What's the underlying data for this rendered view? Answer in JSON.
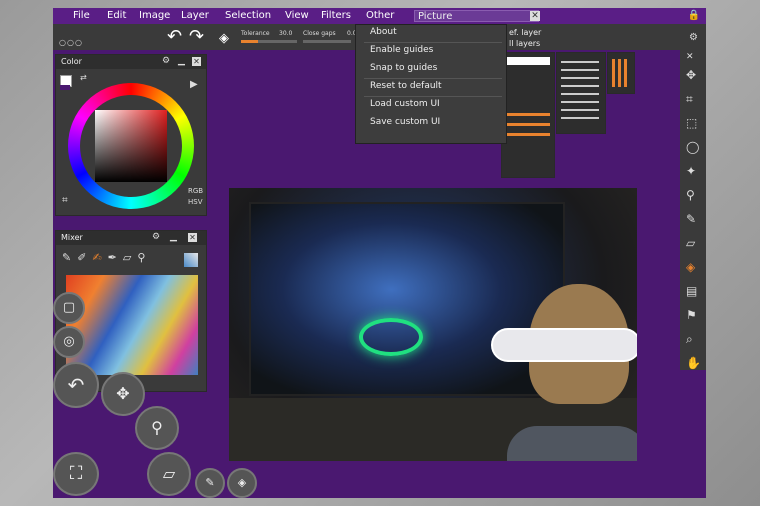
{
  "menu": [
    "File",
    "Edit",
    "Image",
    "Layer",
    "Selection",
    "View",
    "Filters",
    "Other"
  ],
  "picture_field": {
    "value": "Picture"
  },
  "toolbar": {
    "tolerance_label": "Tolerance",
    "tolerance_value": "30.0",
    "tolerance_fill": 0.3,
    "close_gaps_label": "Close gaps",
    "close_gaps_value": "0.0"
  },
  "dropdown": {
    "items": [
      "About",
      "Enable guides",
      "Snap to guides",
      "Reset to default",
      "Load custom UI",
      "Save custom UI"
    ],
    "behind_text_1": "ef. layer",
    "behind_text_2": "ll layers"
  },
  "color_panel": {
    "title": "Color",
    "mode_rgb": "RGB",
    "mode_hsv": "HSV"
  },
  "mixer_panel": {
    "title": "Mixer"
  },
  "colors": {
    "accent": "#e8822e",
    "app_bg": "#4a1870",
    "menubar": "#5a1e86",
    "panel": "#3a3a3a"
  }
}
